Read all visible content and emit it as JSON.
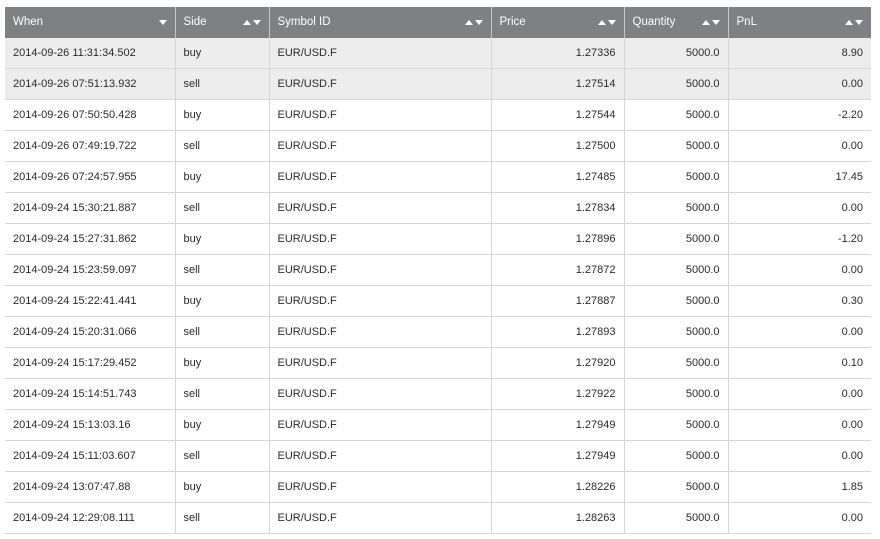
{
  "columns": {
    "when": "When",
    "side": "Side",
    "symbol": "Symbol ID",
    "price": "Price",
    "quantity": "Quantity",
    "pnl": "PnL"
  },
  "colors": {
    "header_bg": "#7f8081",
    "header_text": "#ffffff",
    "selected_row_bg": "#ededed"
  },
  "rows": [
    {
      "when": "2014-09-26 11:31:34.502",
      "side": "buy",
      "symbol": "EUR/USD.F",
      "price": "1.27336",
      "quantity": "5000.0",
      "pnl": "8.90"
    },
    {
      "when": "2014-09-26 07:51:13.932",
      "side": "sell",
      "symbol": "EUR/USD.F",
      "price": "1.27514",
      "quantity": "5000.0",
      "pnl": "0.00"
    },
    {
      "when": "2014-09-26 07:50:50.428",
      "side": "buy",
      "symbol": "EUR/USD.F",
      "price": "1.27544",
      "quantity": "5000.0",
      "pnl": "-2.20"
    },
    {
      "when": "2014-09-26 07:49:19.722",
      "side": "sell",
      "symbol": "EUR/USD.F",
      "price": "1.27500",
      "quantity": "5000.0",
      "pnl": "0.00"
    },
    {
      "when": "2014-09-26 07:24:57.955",
      "side": "buy",
      "symbol": "EUR/USD.F",
      "price": "1.27485",
      "quantity": "5000.0",
      "pnl": "17.45"
    },
    {
      "when": "2014-09-24 15:30:21.887",
      "side": "sell",
      "symbol": "EUR/USD.F",
      "price": "1.27834",
      "quantity": "5000.0",
      "pnl": "0.00"
    },
    {
      "when": "2014-09-24 15:27:31.862",
      "side": "buy",
      "symbol": "EUR/USD.F",
      "price": "1.27896",
      "quantity": "5000.0",
      "pnl": "-1.20"
    },
    {
      "when": "2014-09-24 15:23:59.097",
      "side": "sell",
      "symbol": "EUR/USD.F",
      "price": "1.27872",
      "quantity": "5000.0",
      "pnl": "0.00"
    },
    {
      "when": "2014-09-24 15:22:41.441",
      "side": "buy",
      "symbol": "EUR/USD.F",
      "price": "1.27887",
      "quantity": "5000.0",
      "pnl": "0.30"
    },
    {
      "when": "2014-09-24 15:20:31.066",
      "side": "sell",
      "symbol": "EUR/USD.F",
      "price": "1.27893",
      "quantity": "5000.0",
      "pnl": "0.00"
    },
    {
      "when": "2014-09-24 15:17:29.452",
      "side": "buy",
      "symbol": "EUR/USD.F",
      "price": "1.27920",
      "quantity": "5000.0",
      "pnl": "0.10"
    },
    {
      "when": "2014-09-24 15:14:51.743",
      "side": "sell",
      "symbol": "EUR/USD.F",
      "price": "1.27922",
      "quantity": "5000.0",
      "pnl": "0.00"
    },
    {
      "when": "2014-09-24 15:13:03.16",
      "side": "buy",
      "symbol": "EUR/USD.F",
      "price": "1.27949",
      "quantity": "5000.0",
      "pnl": "0.00"
    },
    {
      "when": "2014-09-24 15:11:03.607",
      "side": "sell",
      "symbol": "EUR/USD.F",
      "price": "1.27949",
      "quantity": "5000.0",
      "pnl": "0.00"
    },
    {
      "when": "2014-09-24 13:07:47.88",
      "side": "buy",
      "symbol": "EUR/USD.F",
      "price": "1.28226",
      "quantity": "5000.0",
      "pnl": "1.85"
    },
    {
      "when": "2014-09-24 12:29:08.111",
      "side": "sell",
      "symbol": "EUR/USD.F",
      "price": "1.28263",
      "quantity": "5000.0",
      "pnl": "0.00"
    }
  ]
}
